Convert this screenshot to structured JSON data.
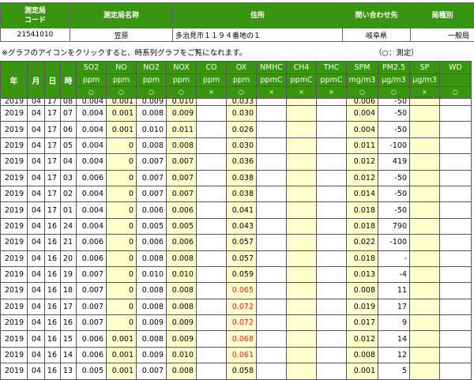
{
  "station": {
    "headers": [
      "測定局\nコード",
      "測定局名称",
      "住所",
      "問い合わせ先",
      "局種別"
    ],
    "values": [
      "21541010",
      "笠原",
      "多治見市１１９４番地の１",
      "岐阜県",
      "一般局"
    ]
  },
  "note": {
    "text": "※グラフのアイコンをクリックすると、時系列グラフをご覧になれます。",
    "legend": "（○：測定）"
  },
  "table": {
    "date_headers": [
      "年",
      "月",
      "日",
      "時"
    ],
    "pollutants": [
      {
        "name": "SO2",
        "unit": "ppm",
        "mark": "○"
      },
      {
        "name": "NO",
        "unit": "ppm",
        "mark": "○"
      },
      {
        "name": "NO2",
        "unit": "ppm",
        "mark": "○"
      },
      {
        "name": "NOX",
        "unit": "ppm",
        "mark": "○"
      },
      {
        "name": "CO",
        "unit": "ppm",
        "mark": "×"
      },
      {
        "name": "OX",
        "unit": "ppm",
        "mark": "○"
      },
      {
        "name": "NMHC",
        "unit": "ppmC",
        "mark": "×"
      },
      {
        "name": "CH4",
        "unit": "ppmC",
        "mark": "×"
      },
      {
        "name": "THC",
        "unit": "ppmC",
        "mark": "×"
      },
      {
        "name": "SPM",
        "unit": "mg/m3",
        "mark": "○"
      },
      {
        "name": "PM2.5",
        "unit": "μg/m3",
        "mark": "○"
      },
      {
        "name": "SP",
        "unit": "μg/m3",
        "mark": "×"
      },
      {
        "name": "WD",
        "unit": "",
        "mark": "○"
      }
    ],
    "rows": [
      {
        "y": "2019",
        "m": "04",
        "d": "17",
        "h": "08",
        "v": [
          "0.004",
          "0.001",
          "0.009",
          "0.010",
          "",
          "0.033",
          "",
          "",
          "",
          "0.006",
          "-50",
          "",
          ""
        ],
        "ox_red": false
      },
      {
        "y": "2019",
        "m": "04",
        "d": "17",
        "h": "07",
        "v": [
          "0.004",
          "0.001",
          "0.008",
          "0.009",
          "",
          "0.030",
          "",
          "",
          "",
          "0.004",
          "-50",
          "",
          ""
        ],
        "ox_red": false
      },
      {
        "y": "2019",
        "m": "04",
        "d": "17",
        "h": "06",
        "v": [
          "0.004",
          "0.001",
          "0.010",
          "0.011",
          "",
          "0.026",
          "",
          "",
          "",
          "0.004",
          "-50",
          "",
          ""
        ],
        "ox_red": false
      },
      {
        "y": "2019",
        "m": "04",
        "d": "17",
        "h": "05",
        "v": [
          "0.004",
          "0",
          "0.008",
          "0.008",
          "",
          "0.030",
          "",
          "",
          "",
          "0.011",
          "-100",
          "",
          ""
        ],
        "ox_red": false
      },
      {
        "y": "2019",
        "m": "04",
        "d": "17",
        "h": "04",
        "v": [
          "0.004",
          "0",
          "0.007",
          "0.007",
          "",
          "0.036",
          "",
          "",
          "",
          "0.012",
          "419",
          "",
          ""
        ],
        "ox_red": false
      },
      {
        "y": "2019",
        "m": "04",
        "d": "17",
        "h": "03",
        "v": [
          "0.006",
          "0",
          "0.007",
          "0.007",
          "",
          "0.038",
          "",
          "",
          "",
          "0.012",
          "-50",
          "",
          ""
        ],
        "ox_red": false
      },
      {
        "y": "2019",
        "m": "04",
        "d": "17",
        "h": "02",
        "v": [
          "0.004",
          "0",
          "0.007",
          "0.007",
          "",
          "0.038",
          "",
          "",
          "",
          "0.014",
          "-50",
          "",
          ""
        ],
        "ox_red": false
      },
      {
        "y": "2019",
        "m": "04",
        "d": "17",
        "h": "01",
        "v": [
          "0.004",
          "0",
          "0.006",
          "0.006",
          "",
          "0.041",
          "",
          "",
          "",
          "0.018",
          "-50",
          "",
          ""
        ],
        "ox_red": false
      },
      {
        "y": "2019",
        "m": "04",
        "d": "16",
        "h": "24",
        "v": [
          "0.004",
          "0",
          "0.005",
          "0.005",
          "",
          "0.043",
          "",
          "",
          "",
          "0.018",
          "790",
          "",
          ""
        ],
        "ox_red": false
      },
      {
        "y": "2019",
        "m": "04",
        "d": "16",
        "h": "21",
        "v": [
          "0.006",
          "0",
          "0.006",
          "0.006",
          "",
          "0.057",
          "",
          "",
          "",
          "0.022",
          "-100",
          "",
          ""
        ],
        "ox_red": false
      },
      {
        "y": "2019",
        "m": "04",
        "d": "16",
        "h": "20",
        "v": [
          "0.006",
          "0",
          "0.008",
          "0.008",
          "",
          "0.057",
          "",
          "",
          "",
          "0.018",
          "-",
          "",
          ""
        ],
        "ox_red": false
      },
      {
        "y": "2019",
        "m": "04",
        "d": "16",
        "h": "19",
        "v": [
          "0.007",
          "0",
          "0.010",
          "0.010",
          "",
          "0.059",
          "",
          "",
          "",
          "0.013",
          "-4",
          "",
          ""
        ],
        "ox_red": false
      },
      {
        "y": "2019",
        "m": "04",
        "d": "16",
        "h": "18",
        "v": [
          "0.007",
          "0",
          "0.008",
          "0.008",
          "",
          "0.065",
          "",
          "",
          "",
          "0.008",
          "11",
          "",
          ""
        ],
        "ox_red": true
      },
      {
        "y": "2019",
        "m": "04",
        "d": "16",
        "h": "17",
        "v": [
          "0.007",
          "0",
          "0.008",
          "0.008",
          "",
          "0.072",
          "",
          "",
          "",
          "0.019",
          "17",
          "",
          ""
        ],
        "ox_red": true
      },
      {
        "y": "2019",
        "m": "04",
        "d": "16",
        "h": "16",
        "v": [
          "0.007",
          "0",
          "0.009",
          "0.009",
          "",
          "0.072",
          "",
          "",
          "",
          "0.017",
          "9",
          "",
          ""
        ],
        "ox_red": true
      },
      {
        "y": "2019",
        "m": "04",
        "d": "16",
        "h": "15",
        "v": [
          "0.006",
          "0.001",
          "0.008",
          "0.009",
          "",
          "0.068",
          "",
          "",
          "",
          "0.012",
          "14",
          "",
          ""
        ],
        "ox_red": true
      },
      {
        "y": "2019",
        "m": "04",
        "d": "16",
        "h": "14",
        "v": [
          "0.006",
          "0.001",
          "0.009",
          "0.010",
          "",
          "0.061",
          "",
          "",
          "",
          "0.008",
          "12",
          "",
          ""
        ],
        "ox_red": true
      },
      {
        "y": "2019",
        "m": "04",
        "d": "16",
        "h": "13",
        "v": [
          "0.005",
          "0.001",
          "0.007",
          "0.008",
          "",
          "0.058",
          "",
          "",
          "",
          "0.001",
          "5",
          "",
          ""
        ],
        "ox_red": false
      }
    ]
  }
}
